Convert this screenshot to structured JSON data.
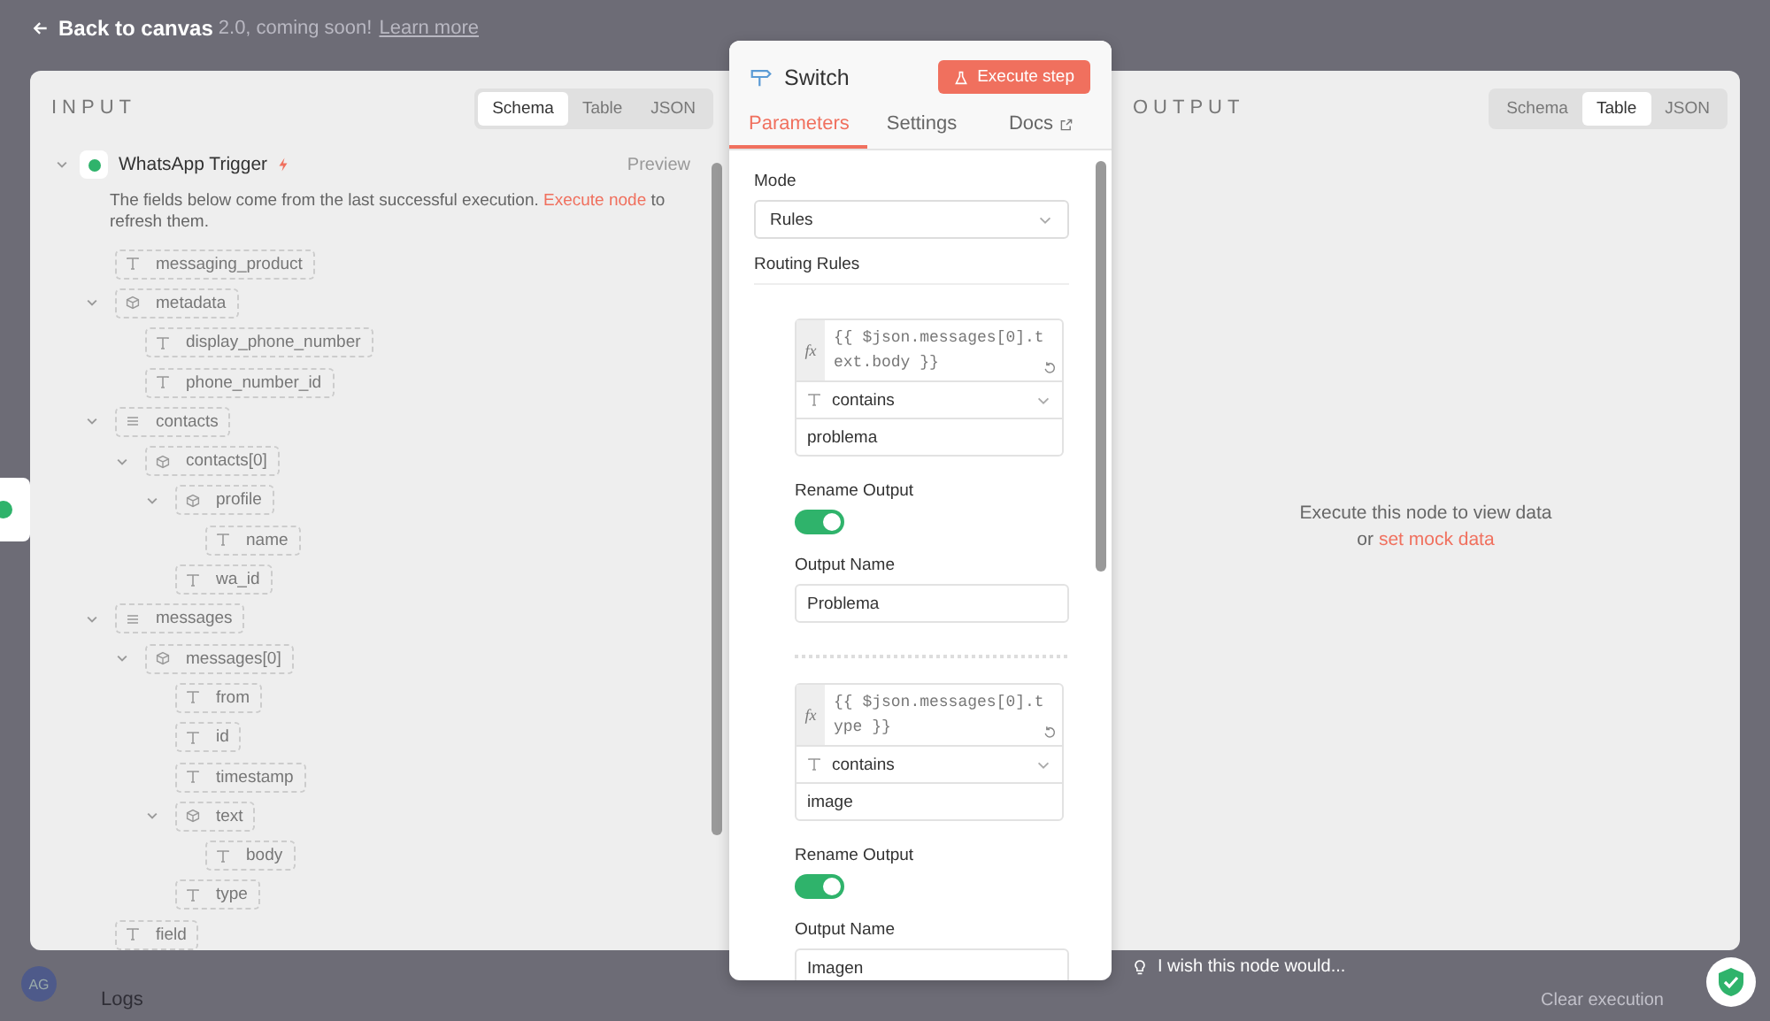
{
  "banner": {
    "text": "2.0, coming soon!",
    "link": "Learn more"
  },
  "back_button": {
    "label": "Back to canvas"
  },
  "input": {
    "title": "INPUT",
    "tabs": [
      {
        "label": "Schema",
        "selected": true
      },
      {
        "label": "Table",
        "selected": false
      },
      {
        "label": "JSON",
        "selected": false
      }
    ],
    "node": {
      "name": "WhatsApp Trigger",
      "expanded": true,
      "preview": "Preview"
    },
    "notice": {
      "text": "The fields below come from the last successful execution.",
      "link": "Execute node",
      "suffix": "to refresh them."
    },
    "fields": [
      {
        "name": "messaging_product",
        "kind": "string"
      },
      {
        "name": "metadata",
        "kind": "object",
        "expanded": true,
        "children": [
          {
            "name": "display_phone_number",
            "kind": "string"
          },
          {
            "name": "phone_number_id",
            "kind": "string"
          }
        ]
      },
      {
        "name": "contacts",
        "kind": "array",
        "expanded": true,
        "children": [
          {
            "name": "contacts[0]",
            "kind": "object",
            "expanded": true,
            "children": [
              {
                "name": "profile",
                "kind": "object",
                "expanded": true,
                "children": [
                  {
                    "name": "name",
                    "kind": "string"
                  }
                ]
              },
              {
                "name": "wa_id",
                "kind": "string"
              }
            ]
          }
        ]
      },
      {
        "name": "messages",
        "kind": "array",
        "expanded": true,
        "children": [
          {
            "name": "messages[0]",
            "kind": "object",
            "expanded": true,
            "children": [
              {
                "name": "from",
                "kind": "string"
              },
              {
                "name": "id",
                "kind": "string"
              },
              {
                "name": "timestamp",
                "kind": "string"
              },
              {
                "name": "text",
                "kind": "object",
                "expanded": true,
                "children": [
                  {
                    "name": "body",
                    "kind": "string"
                  }
                ]
              },
              {
                "name": "type",
                "kind": "string"
              }
            ]
          }
        ]
      },
      {
        "name": "field",
        "kind": "string"
      }
    ]
  },
  "node_panel": {
    "title": "Switch",
    "execute_button": "Execute step",
    "tabs": [
      {
        "label": "Parameters",
        "selected": true,
        "kind": "internal"
      },
      {
        "label": "Settings",
        "selected": false,
        "kind": "internal"
      },
      {
        "label": "Docs",
        "selected": false,
        "kind": "external"
      }
    ],
    "mode": {
      "label": "Mode",
      "value": "Rules"
    },
    "routing_rules_label": "Routing Rules",
    "rules": [
      {
        "expression_label": "fx",
        "expression": "{{ $json.messages[0].text.body }}",
        "operator": "contains",
        "value": "problema",
        "rename_label": "Rename Output",
        "rename_output": true,
        "output_name_label": "Output Name",
        "output_name": "Problema"
      },
      {
        "expression_label": "fx",
        "expression": "{{ $json.messages[0].type }}",
        "operator": "contains",
        "value": "image",
        "rename_label": "Rename Output",
        "rename_output": true,
        "output_name_label": "Output Name",
        "output_name": "Imagen"
      }
    ]
  },
  "output": {
    "title": "OUTPUT",
    "tabs": [
      {
        "label": "Schema",
        "selected": false
      },
      {
        "label": "Table",
        "selected": true
      },
      {
        "label": "JSON",
        "selected": false
      }
    ],
    "empty_message": "Execute this node to view data",
    "mock_prefix": "or",
    "mock_link": "set mock data"
  },
  "footer": {
    "avatar": "AG",
    "logs": "Logs",
    "clear": "Clear execution",
    "feedback": "I wish this node would..."
  }
}
